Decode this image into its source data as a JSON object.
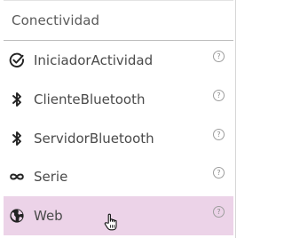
{
  "category": {
    "title": "Conectividad"
  },
  "items": [
    {
      "label": "IniciadorActividad",
      "icon": "check-circle-icon",
      "help": "?",
      "selected": false
    },
    {
      "label": "ClienteBluetooth",
      "icon": "bluetooth-icon",
      "help": "?",
      "selected": false
    },
    {
      "label": "ServidorBluetooth",
      "icon": "bluetooth-icon",
      "help": "?",
      "selected": false
    },
    {
      "label": "Serie",
      "icon": "infinity-icon",
      "help": "?",
      "selected": false
    },
    {
      "label": "Web",
      "icon": "globe-icon",
      "help": "?",
      "selected": true
    }
  ],
  "colors": {
    "selected_background": "#ecd3e8",
    "text": "#4a4a4a"
  }
}
